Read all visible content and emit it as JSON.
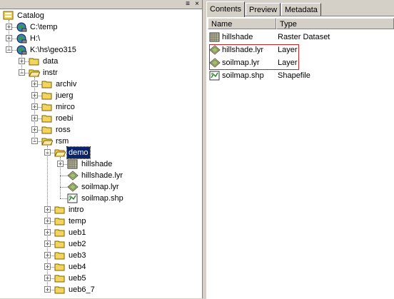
{
  "tabs": [
    {
      "label": "Contents"
    },
    {
      "label": "Preview"
    },
    {
      "label": "Metadata"
    }
  ],
  "columns": {
    "name": "Name",
    "type": "Type"
  },
  "contents": [
    {
      "name": "hillshade",
      "type": "Raster Dataset",
      "icon": "raster-dataset-icon"
    },
    {
      "name": "hillshade.lyr",
      "type": "Layer",
      "icon": "layer-file-icon"
    },
    {
      "name": "soilmap.lyr",
      "type": "Layer",
      "icon": "layer-file-icon"
    },
    {
      "name": "soilmap.shp",
      "type": "Shapefile",
      "icon": "shapefile-icon"
    }
  ],
  "tree": [
    {
      "label": "Catalog",
      "icon": "catalog-icon",
      "depth": 0,
      "toggle": "none"
    },
    {
      "label": "C:\\temp",
      "icon": "folder-connection-icon",
      "depth": 1,
      "toggle": "+"
    },
    {
      "label": "H:\\",
      "icon": "folder-connection-icon",
      "depth": 1,
      "toggle": "+"
    },
    {
      "label": "K:\\hs\\geo315",
      "icon": "folder-connection-icon",
      "depth": 1,
      "toggle": "-"
    },
    {
      "label": "data",
      "icon": "folder-icon",
      "depth": 2,
      "toggle": "+"
    },
    {
      "label": "instr",
      "icon": "folder-open-icon",
      "depth": 2,
      "toggle": "-"
    },
    {
      "label": "archiv",
      "icon": "folder-icon",
      "depth": 3,
      "toggle": "+"
    },
    {
      "label": "juerg",
      "icon": "folder-icon",
      "depth": 3,
      "toggle": "+"
    },
    {
      "label": "mirco",
      "icon": "folder-icon",
      "depth": 3,
      "toggle": "+"
    },
    {
      "label": "roebi",
      "icon": "folder-icon",
      "depth": 3,
      "toggle": "+"
    },
    {
      "label": "ross",
      "icon": "folder-icon",
      "depth": 3,
      "toggle": "+"
    },
    {
      "label": "rsm",
      "icon": "folder-open-icon",
      "depth": 3,
      "toggle": "-"
    },
    {
      "label": "demo",
      "icon": "folder-open-icon",
      "depth": 4,
      "toggle": "-",
      "selected": true
    },
    {
      "label": "hillshade",
      "icon": "raster-dataset-icon",
      "depth": 5,
      "toggle": "+"
    },
    {
      "label": "hillshade.lyr",
      "icon": "layer-file-icon",
      "depth": 5,
      "toggle": "none"
    },
    {
      "label": "soilmap.lyr",
      "icon": "layer-file-icon",
      "depth": 5,
      "toggle": "none"
    },
    {
      "label": "soilmap.shp",
      "icon": "shapefile-icon",
      "depth": 5,
      "toggle": "none"
    },
    {
      "label": "intro",
      "icon": "folder-icon",
      "depth": 4,
      "toggle": "+"
    },
    {
      "label": "temp",
      "icon": "folder-icon",
      "depth": 4,
      "toggle": "+"
    },
    {
      "label": "ueb1",
      "icon": "folder-icon",
      "depth": 4,
      "toggle": "+"
    },
    {
      "label": "ueb2",
      "icon": "folder-icon",
      "depth": 4,
      "toggle": "+"
    },
    {
      "label": "ueb3",
      "icon": "folder-icon",
      "depth": 4,
      "toggle": "+"
    },
    {
      "label": "ueb4",
      "icon": "folder-icon",
      "depth": 4,
      "toggle": "+"
    },
    {
      "label": "ueb5",
      "icon": "folder-icon",
      "depth": 4,
      "toggle": "+"
    },
    {
      "label": "ueb6_7",
      "icon": "folder-icon",
      "depth": 4,
      "toggle": "+"
    }
  ],
  "colors": {
    "selection": "#0a246a",
    "highlight_box": "#cc2222",
    "folder": "#f2d55f"
  }
}
